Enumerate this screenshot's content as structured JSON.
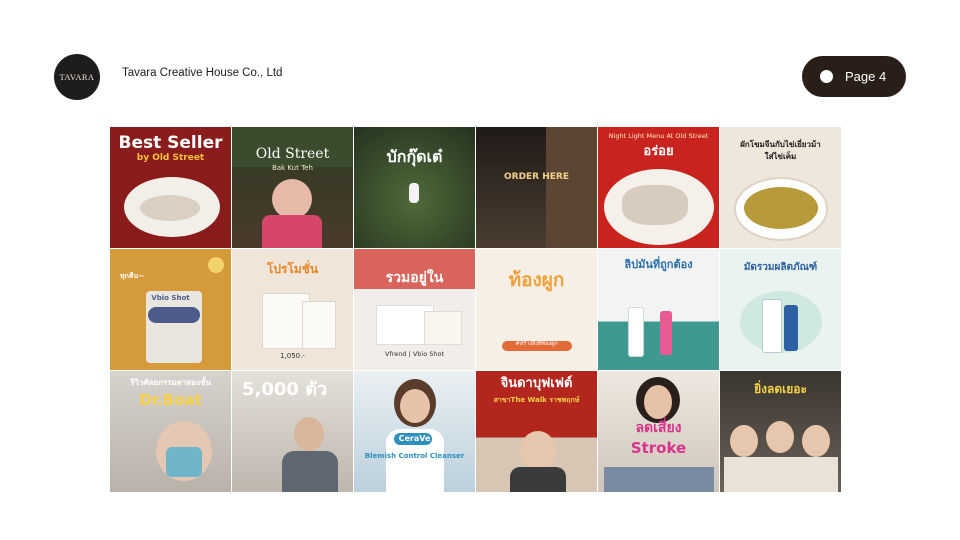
{
  "header": {
    "logo_text": "TAVARA",
    "company": "Tavara Creative House Co., Ltd",
    "page_label": "Page 4"
  },
  "tiles": {
    "t1": {
      "title": "Best Seller",
      "sub": "by Old Street",
      "bg": "#8a1c1c"
    },
    "t2": {
      "title": "Old Street",
      "sub": "Bak Kut Teh",
      "bg": "#3b4a2e"
    },
    "t3": {
      "title": "บักกุ๊ดเต๋",
      "bg": "#34452c"
    },
    "t4": {
      "title": "ORDER HERE",
      "bg": "#2b2520"
    },
    "t5": {
      "title": "อร่อย",
      "sub": "Night Light Menu At Old Street",
      "bg": "#c9231f"
    },
    "t6": {
      "title": "ผักโขมจีนกับไข่เยี่ยวม้า",
      "sub": "ใส่ไข่เค็ม",
      "bg": "#efe7dc"
    },
    "t7": {
      "title": "Vbio Shot",
      "badge": "ทุกคืน~",
      "bg": "#d59a3a"
    },
    "t8": {
      "title": "โปรโมชั่น",
      "sub": "1,050.-",
      "bg": "#efe5d8"
    },
    "t9": {
      "title": "รวมอยู่ใน",
      "sub": "Vfrend | Vbio Shot",
      "bg": "#f1ede9"
    },
    "t10": {
      "title": "ท้องผูก",
      "sub": "#สร้างสิ่งที่ท้องผูก",
      "bg": "#f6efe6"
    },
    "t11": {
      "title": "ลิปมันที่ถูกต้อง",
      "bg": "#eef1f3"
    },
    "t12": {
      "title": "มัดรวมผลิตภัณฑ์",
      "bg": "#e9f3ef"
    },
    "t13": {
      "title": "Dr.Boat",
      "sub": "รีวิวศัลยกรรมตาสองชั้น",
      "bg": "#c8c4bd"
    },
    "t14": {
      "title": "5,000 ตัว",
      "bg": "#d8d4cf"
    },
    "t15": {
      "title": "CeraVe",
      "sub": "Blemish Control Cleanser",
      "bg": "#dce6ec"
    },
    "t16": {
      "title": "จินดาบุฟเฟต์",
      "sub": "สาขาThe Walk ราชพฤกษ์",
      "bg": "#b3261e"
    },
    "t17": {
      "title": "ลดเสี่ยง",
      "sub": "Stroke",
      "bg": "#e9e3db"
    },
    "t18": {
      "title": "ยิ่งลดเยอะ",
      "bg": "#4b463f"
    }
  }
}
